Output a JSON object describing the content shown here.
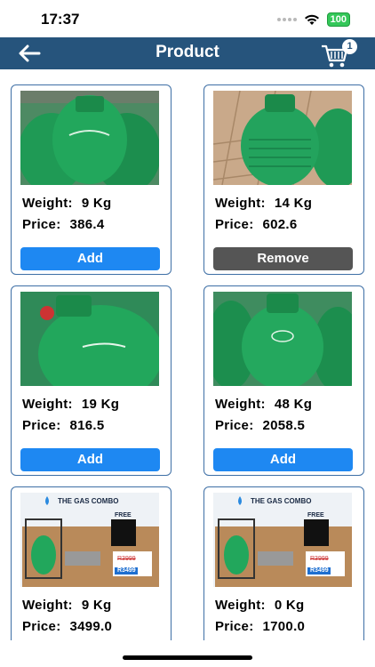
{
  "status": {
    "time": "17:37",
    "battery": "100"
  },
  "header": {
    "title": "Product",
    "cart_count": "1"
  },
  "products": [
    {
      "weight_label": "Weight:",
      "weight": "9 Kg",
      "price_label": "Price:",
      "price": "386.4",
      "button": "Add",
      "button_type": "add"
    },
    {
      "weight_label": "Weight:",
      "weight": "14 Kg",
      "price_label": "Price:",
      "price": "602.6",
      "button": "Remove",
      "button_type": "remove"
    },
    {
      "weight_label": "Weight:",
      "weight": "19 Kg",
      "price_label": "Price:",
      "price": "816.5",
      "button": "Add",
      "button_type": "add"
    },
    {
      "weight_label": "Weight:",
      "weight": "48 Kg",
      "price_label": "Price:",
      "price": "2058.5",
      "button": "Add",
      "button_type": "add"
    },
    {
      "weight_label": "Weight:",
      "weight": "9 Kg",
      "price_label": "Price:",
      "price": "3499.0",
      "promo_title": "THE GAS COMBO",
      "promo_free": "FREE",
      "promo_old_price": "R3999",
      "promo_new_price": "R3499"
    },
    {
      "weight_label": "Weight:",
      "weight": "0 Kg",
      "price_label": "Price:",
      "price": "1700.0",
      "promo_title": "THE GAS COMBO",
      "promo_free": "FREE",
      "promo_old_price": "R3999",
      "promo_new_price": "R3499"
    }
  ],
  "colors": {
    "header": "#26547c",
    "add_button": "#1e88f2",
    "remove_button": "#555555",
    "card_border": "#3e6fa6",
    "cylinder_green": "#1f9a55"
  }
}
